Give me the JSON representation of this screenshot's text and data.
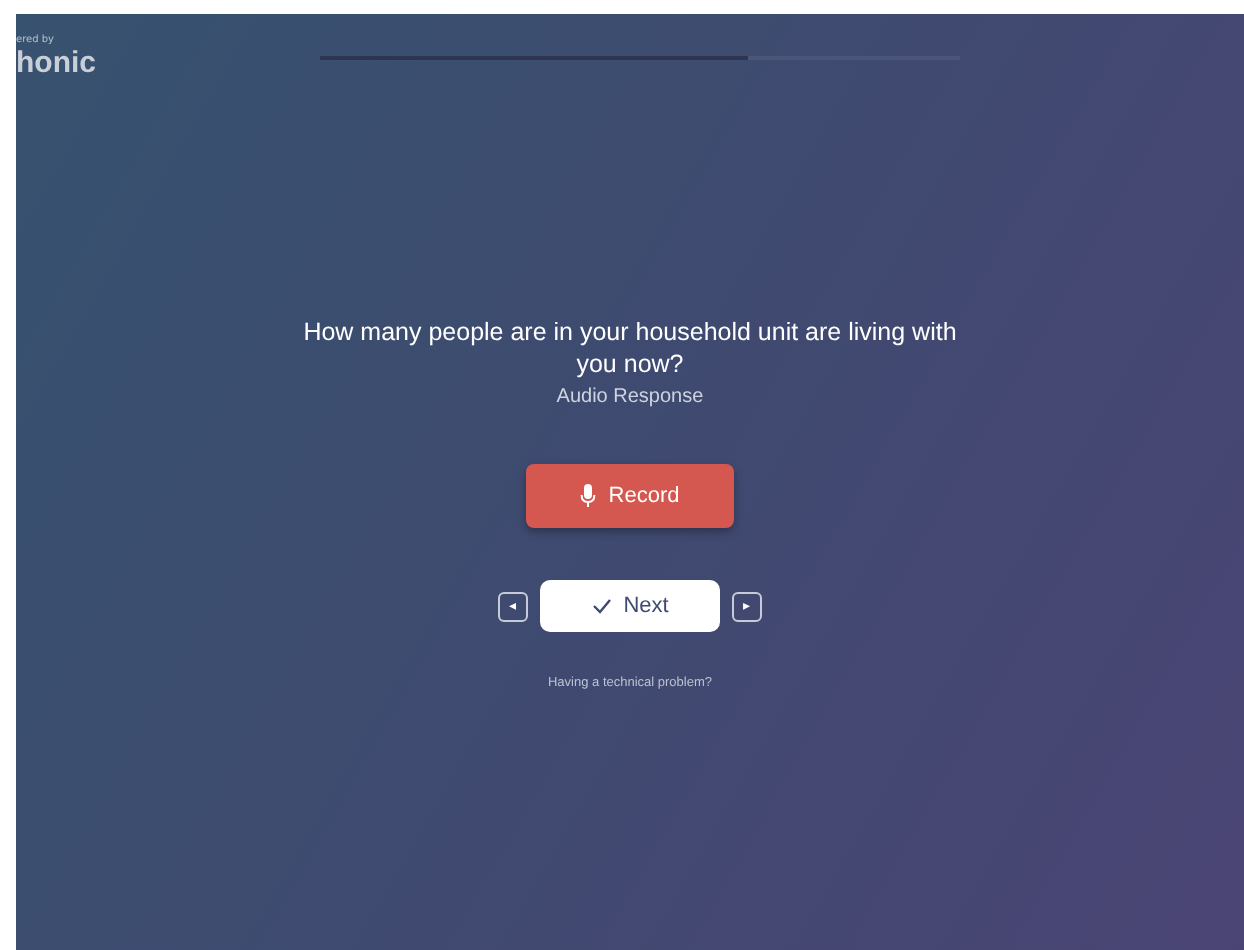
{
  "brand": {
    "tagline": "ered by",
    "name": "honic"
  },
  "progress": {
    "level": 0.67
  },
  "question": {
    "text": "How many people are in your household unit are living with you now?",
    "subtitle": "Audio Response"
  },
  "record_button": {
    "label": "Record"
  },
  "navigation": {
    "prev_icon": "◂",
    "next_label": "Next",
    "next_icon": "▸"
  },
  "help_link": "Having a technical problem?"
}
